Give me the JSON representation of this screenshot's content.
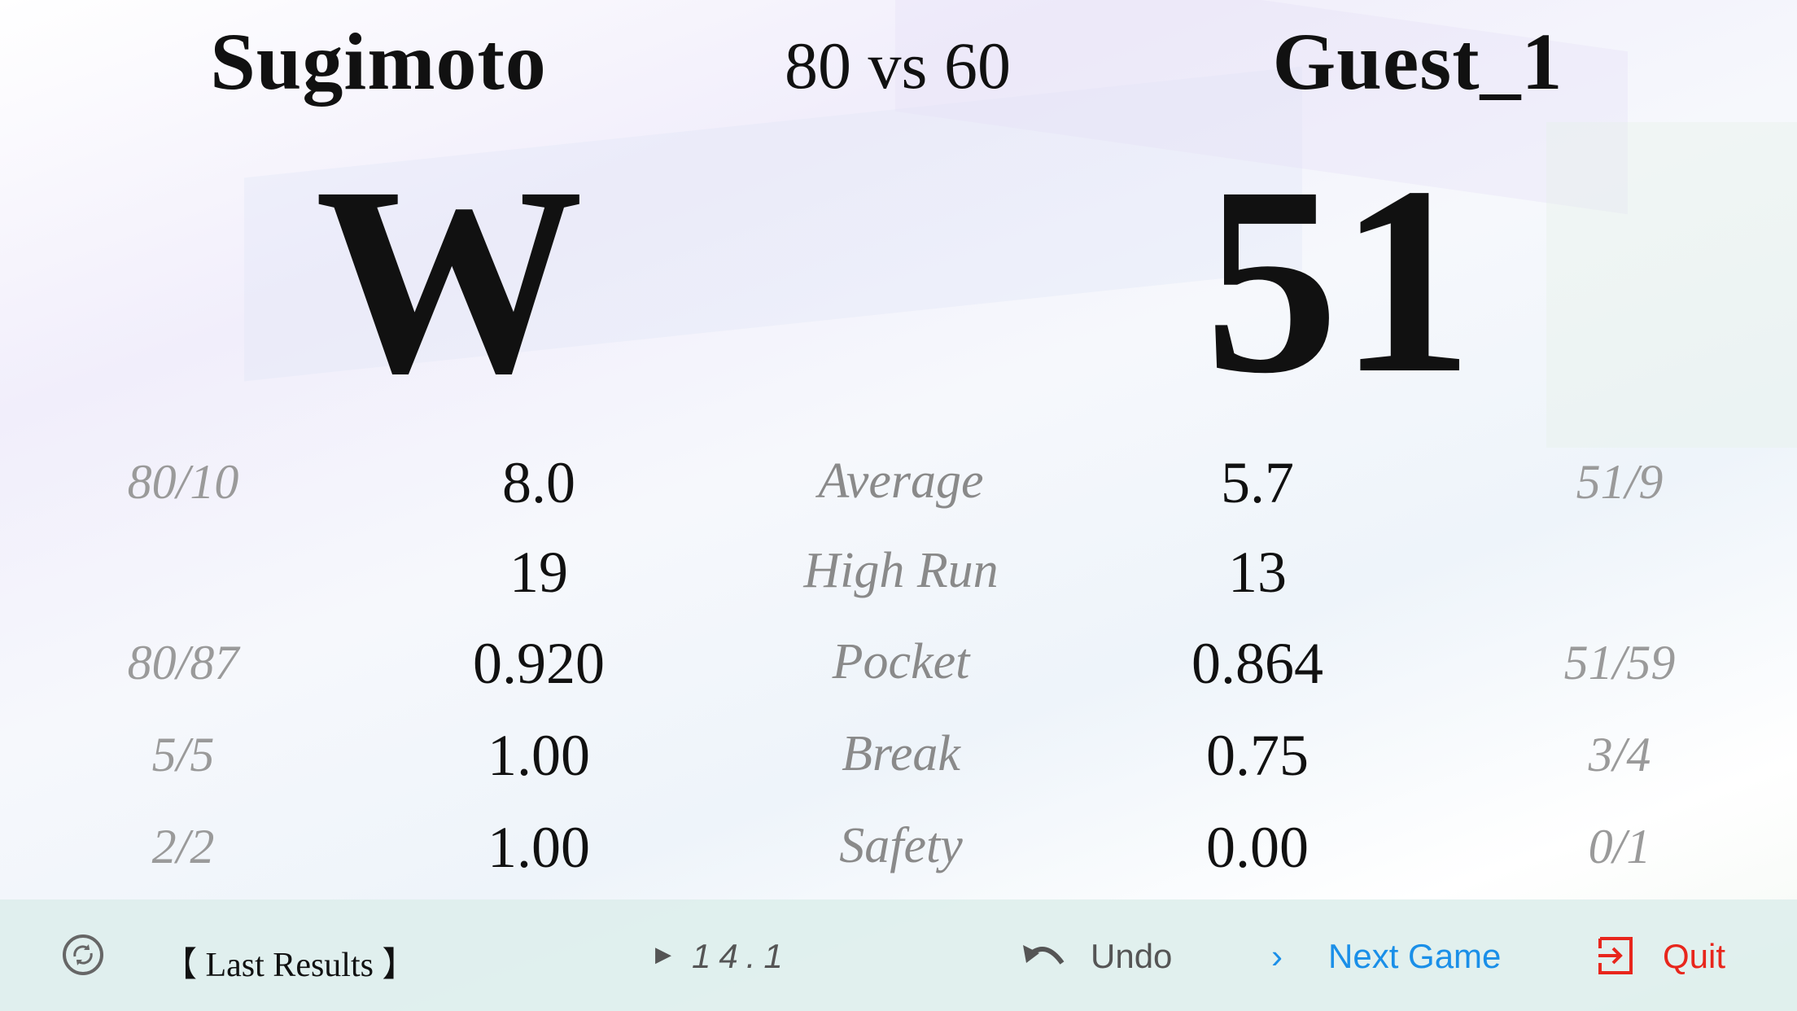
{
  "header": {
    "player1": "Sugimoto",
    "player2": "Guest_1",
    "race_label": "80  vs  60"
  },
  "scores": {
    "player1": "W",
    "player2": "51"
  },
  "stats": [
    {
      "label": "Average",
      "p1_fraction": "80/10",
      "p1_value": "8.0",
      "p2_value": "5.7",
      "p2_fraction": "51/9"
    },
    {
      "label": "High Run",
      "p1_fraction": "",
      "p1_value": "19",
      "p2_value": "13",
      "p2_fraction": ""
    },
    {
      "label": "Pocket",
      "p1_fraction": "80/87",
      "p1_value": "0.920",
      "p2_value": "0.864",
      "p2_fraction": "51/59"
    },
    {
      "label": "Break",
      "p1_fraction": "5/5",
      "p1_value": "1.00",
      "p2_value": "0.75",
      "p2_fraction": "3/4"
    },
    {
      "label": "Safety",
      "p1_fraction": "2/2",
      "p1_value": "1.00",
      "p2_value": "0.00",
      "p2_fraction": "0/1"
    }
  ],
  "footer": {
    "last_results": "【 Last Results 】",
    "game_type": "14.1",
    "undo": "Undo",
    "next_game": "Next Game",
    "quit": "Quit",
    "icons": [
      "refresh-icon",
      "play-triangle-icon",
      "undo-arrow-icon",
      "chevron-right-icon",
      "exit-icon"
    ],
    "colors": {
      "next_game": "#1a8fe8",
      "quit": "#e8261c",
      "undo": "#555555"
    }
  }
}
